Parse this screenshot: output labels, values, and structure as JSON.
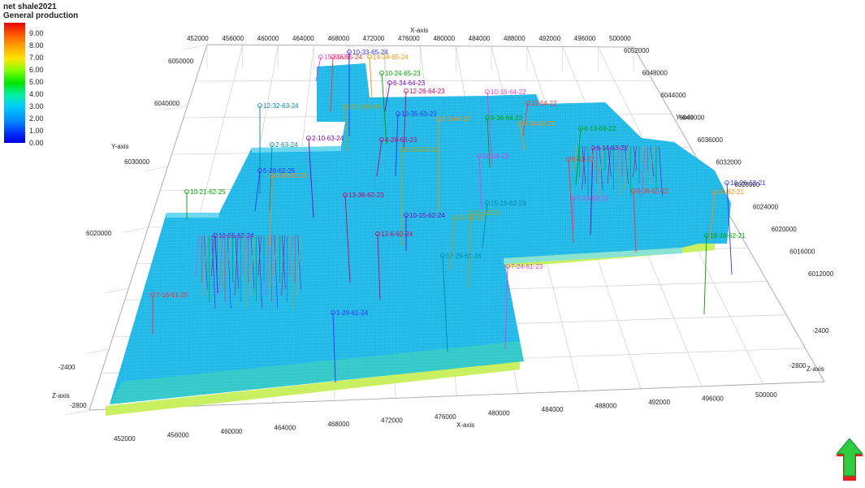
{
  "title": {
    "line1": "net shale2021",
    "line2": "General production"
  },
  "legend": {
    "ticks": [
      "9.00",
      "8.00",
      "7.00",
      "6.00",
      "5.00",
      "4.00",
      "3.00",
      "2.00",
      "1.00",
      "0.00"
    ]
  },
  "axes": {
    "x_title": "X-axis",
    "y_title": "Y-axis",
    "z_title": "Z-axis",
    "x_ticks_bottom": [
      "452000",
      "456000",
      "460000",
      "464000",
      "468000",
      "472000",
      "476000",
      "480000",
      "484000",
      "488000",
      "492000",
      "496000",
      "500000"
    ],
    "x_ticks_top": [
      "452000",
      "456000",
      "460000",
      "464000",
      "468000",
      "472000",
      "476000",
      "480000",
      "484000",
      "488000",
      "492000",
      "496000",
      "500000"
    ],
    "y_ticks_left": [
      "6050000",
      "6040000",
      "6030000",
      "6020000"
    ],
    "y_ticks_right": [
      "6052000",
      "6048000",
      "6044000",
      "6040000",
      "6036000",
      "6032000",
      "6028000",
      "6024000",
      "6020000",
      "6016000",
      "6012000"
    ],
    "z_ticks_left": [
      "-2400",
      "-2800"
    ],
    "z_ticks_right": [
      "-2400",
      "-2800"
    ]
  },
  "wells": [
    "15-55-24",
    "16-55-24",
    "10-33-65-24",
    "14-34-65-24",
    "10-24-65-23",
    "6-34-64-23",
    "12-26-64-23",
    "12-32-63-24",
    "12-1-64-24",
    "10-16-64-22",
    "11-64-22",
    "10-35-63-23",
    "1-3-64-23",
    "9-36-64-22",
    "2-10-63-24",
    "4-28-63-23",
    "2-63-24",
    "6-26-63-23",
    "16-53-23",
    "9-63-22",
    "5-26-62-25",
    "4-36-62-25",
    "10-21-62-25",
    "10-55-62-24",
    "13-36-62-23",
    "15-15-62-23",
    "11-62-23",
    "7-23-62-22",
    "9-36-62-22",
    "10-26-62-21",
    "10-62-21",
    "16-24-62-21",
    "10-15-62-24",
    "12-6-62-24",
    "12-29-61-24",
    "12-61-23",
    "7-24-61-23",
    "7-16-61-25",
    "1-29-61-24",
    "9-24-63-22",
    "4-13-63-22",
    "6-14-63-22"
  ],
  "colors": {
    "surface": "#22b8e8",
    "surface_mesh": "#4fd0f0",
    "bottom_layer": "#c8f060",
    "grid": "#c8c8c8",
    "arrow_green": "#2ecc40",
    "arrow_red": "#e02020"
  }
}
